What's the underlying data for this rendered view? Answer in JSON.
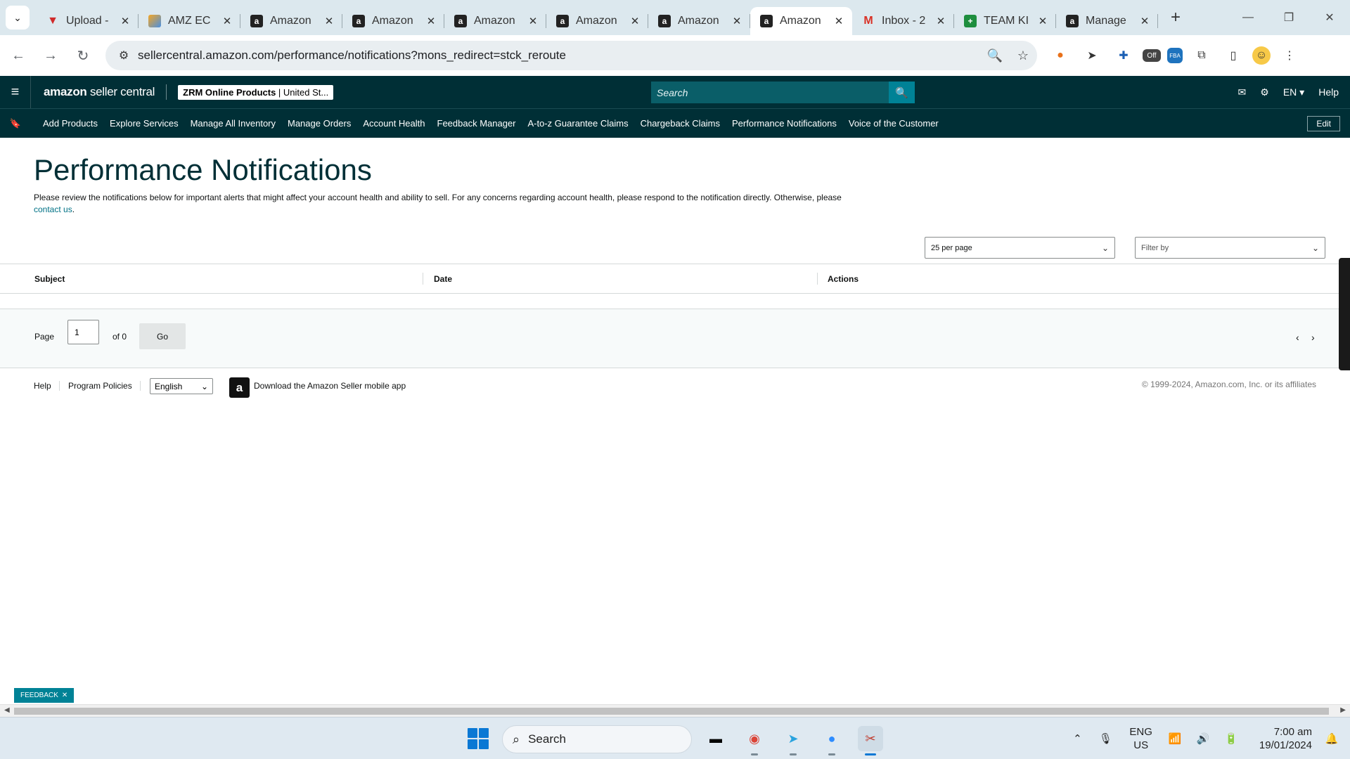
{
  "browser": {
    "tabs": [
      {
        "title": "Upload -",
        "favicon": "upload-favicon"
      },
      {
        "title": "AMZ EC",
        "favicon": "amz-favicon"
      },
      {
        "title": "Amazon",
        "favicon": "amazon-favicon"
      },
      {
        "title": "Amazon",
        "favicon": "amazon-favicon"
      },
      {
        "title": "Amazon",
        "favicon": "amazon-favicon"
      },
      {
        "title": "Amazon",
        "favicon": "amazon-favicon"
      },
      {
        "title": "Amazon",
        "favicon": "amazon-favicon"
      },
      {
        "title": "Amazon",
        "favicon": "amazon-favicon",
        "active": true
      },
      {
        "title": "Inbox - 2",
        "favicon": "gmail-favicon"
      },
      {
        "title": "TEAM KI",
        "favicon": "sheets-favicon"
      },
      {
        "title": "Manage",
        "favicon": "amazon-favicon"
      }
    ],
    "url": "sellercentral.amazon.com/performance/notifications?mons_redirect=stck_reroute",
    "extension_badge": "Off"
  },
  "header": {
    "logo_main": "amazon",
    "logo_sub": "seller central",
    "store_name": "ZRM Online Products",
    "store_region": "United St...",
    "search_placeholder": "Search",
    "language": "EN",
    "help": "Help"
  },
  "nav": {
    "items": [
      "Add Products",
      "Explore Services",
      "Manage All Inventory",
      "Manage Orders",
      "Account Health",
      "Feedback Manager",
      "A-to-z Guarantee Claims",
      "Chargeback Claims",
      "Performance Notifications",
      "Voice of the Customer"
    ],
    "edit": "Edit"
  },
  "main": {
    "title": "Performance Notifications",
    "description": "Please review the notifications below for important alerts that might affect your account health and ability to sell. For any concerns regarding account health, please respond to the notification directly. Otherwise, please",
    "contact_link": "contact us",
    "per_page": "25 per page",
    "filter_placeholder": "Filter by",
    "columns": [
      "Subject",
      "Date",
      "Actions"
    ],
    "pager": {
      "page_label": "Page",
      "page_value": "1",
      "of_label": "of 0",
      "go": "Go"
    }
  },
  "footer": {
    "help": "Help",
    "program_policies": "Program Policies",
    "language": "English",
    "app_text": "Download the Amazon Seller mobile app",
    "copyright": "© 1999-2024, Amazon.com, Inc. or its affiliates"
  },
  "feedback_tab": "FEEDBACK",
  "taskbar": {
    "search": "Search",
    "lang_line1": "ENG",
    "lang_line2": "US",
    "time": "7:00 am",
    "date": "19/01/2024"
  },
  "colors": {
    "amazon_header": "#002f36",
    "search_button": "#008296",
    "title": "#002f36",
    "link": "#007185"
  }
}
